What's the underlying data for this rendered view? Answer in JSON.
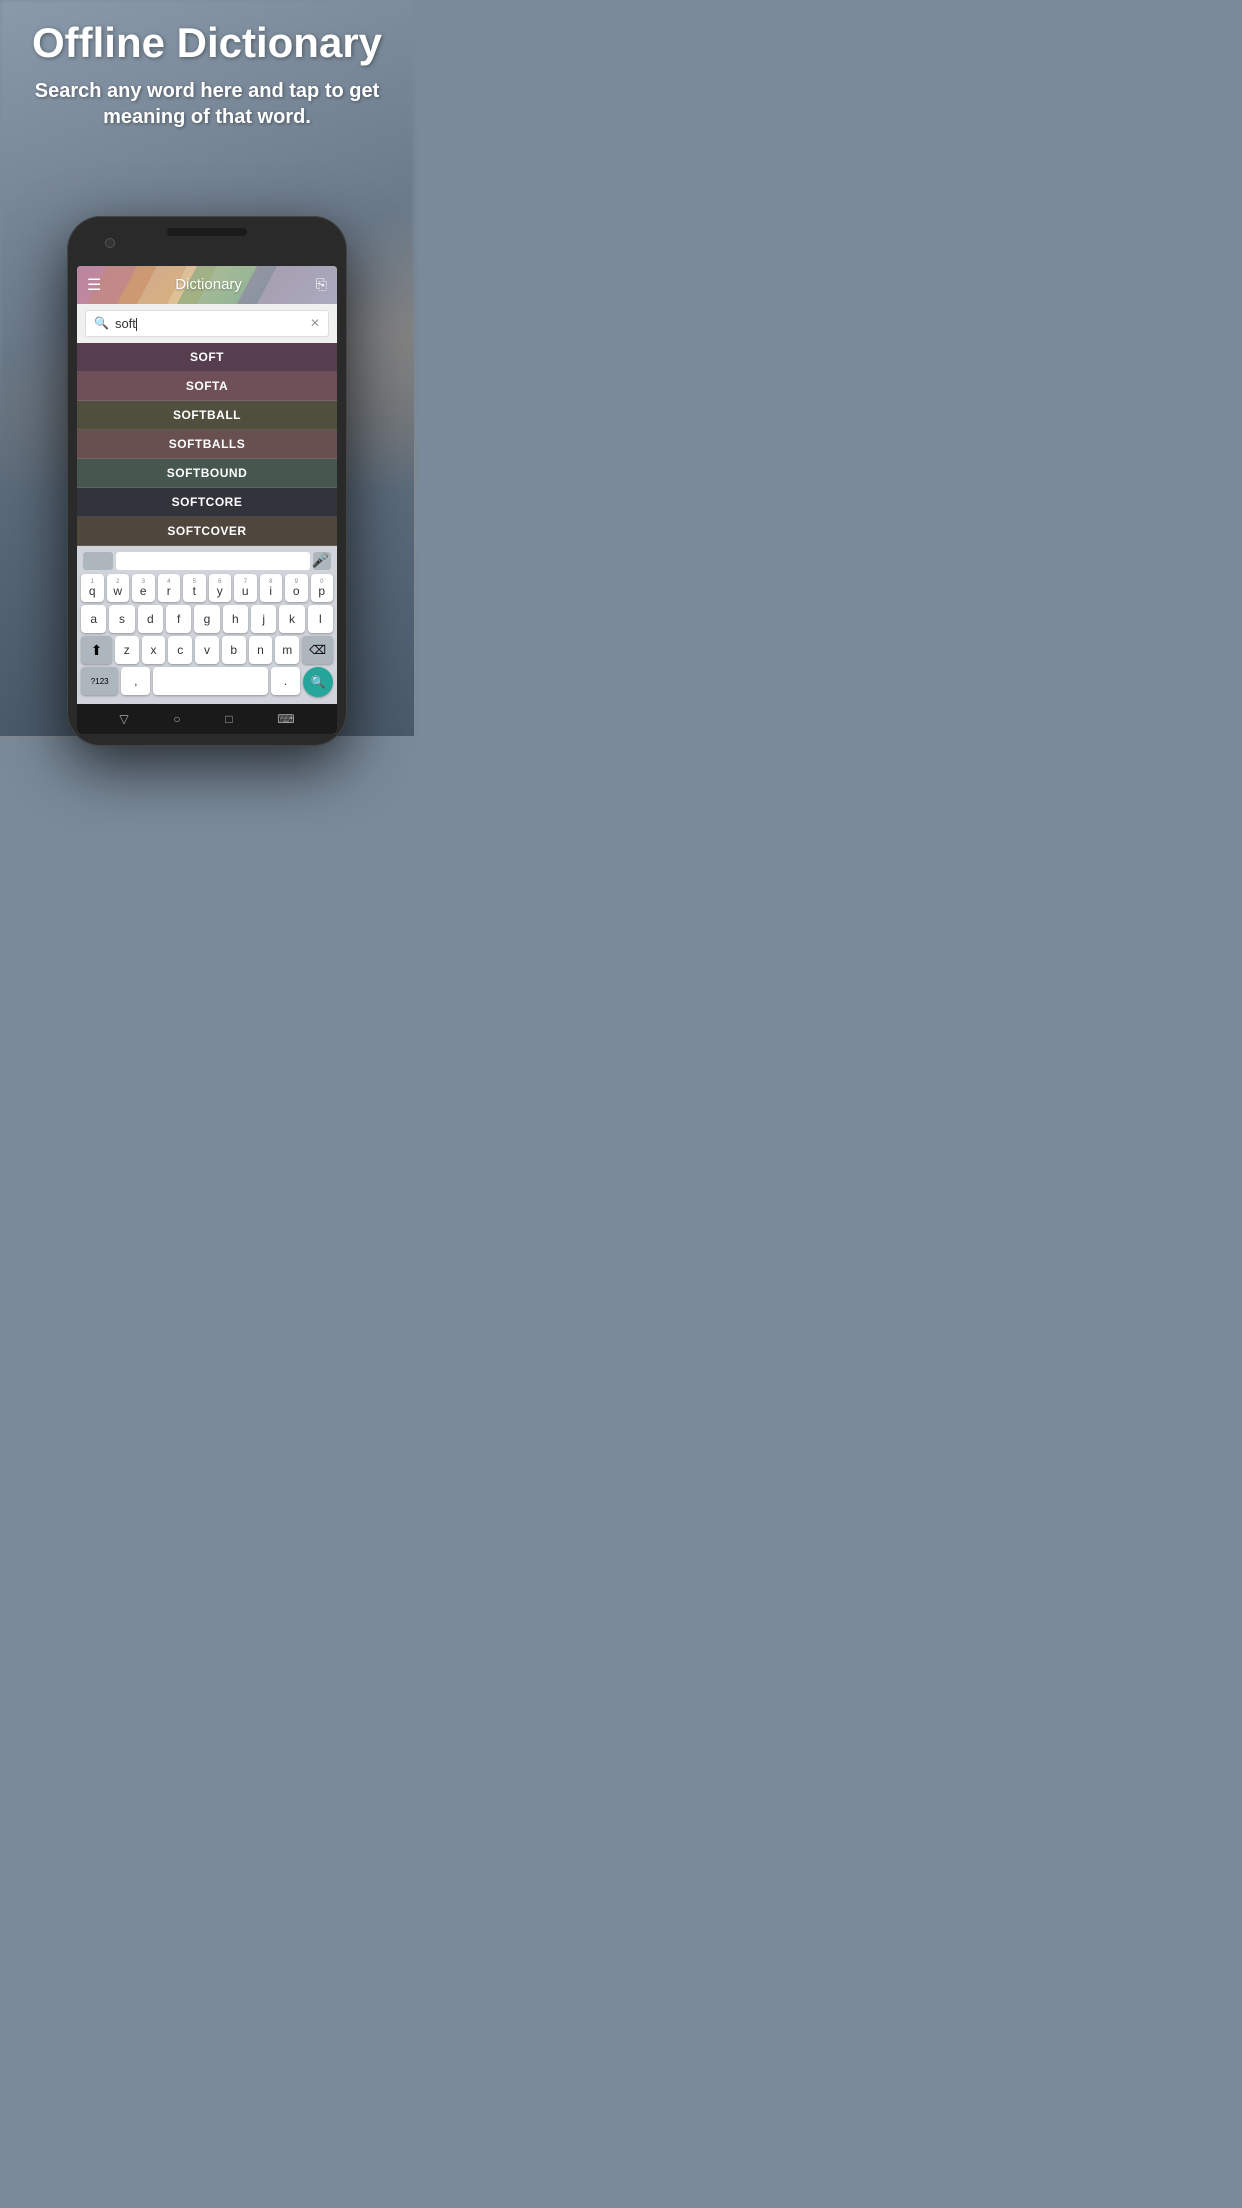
{
  "page": {
    "title": "Offline Dictionary",
    "subtitle": "Search any word here and tap to get meaning of that word."
  },
  "app": {
    "header": {
      "title": "Dictionary",
      "menu_icon": "☰",
      "share_icon": "⎘"
    },
    "search": {
      "placeholder": "soft",
      "value": "soft",
      "clear_icon": "✕"
    },
    "word_list": [
      {
        "word": "SOFT"
      },
      {
        "word": "SOFTA"
      },
      {
        "word": "SOFTBALL"
      },
      {
        "word": "SOFTBALLS"
      },
      {
        "word": "SOFTBOUND"
      },
      {
        "word": "SOFTCORE"
      },
      {
        "word": "SOFTCOVER"
      }
    ],
    "keyboard": {
      "rows": [
        [
          "q",
          "w",
          "e",
          "r",
          "t",
          "y",
          "u",
          "i",
          "o",
          "p"
        ],
        [
          "a",
          "s",
          "d",
          "f",
          "g",
          "h",
          "j",
          "k",
          "l"
        ],
        [
          "z",
          "x",
          "c",
          "v",
          "b",
          "n",
          "m"
        ]
      ],
      "numbers": [
        "1",
        "2",
        "3",
        "4",
        "5",
        "6",
        "7",
        "8",
        "9",
        "0"
      ],
      "special_left": "?123",
      "special_comma": ",",
      "special_period": ".",
      "search_button": "🔍",
      "delete_icon": "⌫",
      "shift_icon": "⇧"
    },
    "bottom_nav": {
      "back": "▽",
      "home": "○",
      "recent": "□",
      "keyboard": "⌨"
    }
  }
}
